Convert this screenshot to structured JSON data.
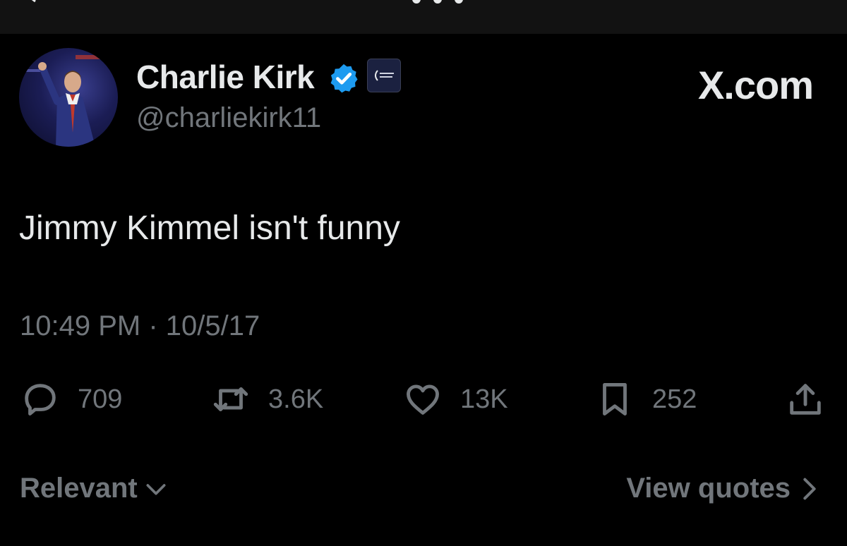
{
  "post": {
    "author": {
      "display_name": "Charlie Kirk",
      "handle": "@charliekirk11",
      "verified": true,
      "affiliate_badge": "turning-point-usa-logo"
    },
    "brand": "X.com",
    "text": "Jimmy Kimmel isn't funny",
    "timestamp": "10:49 PM · 10/5/17",
    "metrics": {
      "replies": "709",
      "reposts": "3.6K",
      "likes": "13K",
      "bookmarks": "252"
    }
  },
  "footer": {
    "sort_label": "Relevant",
    "quotes_link": "View quotes"
  },
  "icons": {
    "reply": "reply-icon",
    "repost": "repost-icon",
    "like": "like-icon",
    "bookmark": "bookmark-icon",
    "share": "share-icon"
  },
  "colors": {
    "background": "#000000",
    "topbar": "#121212",
    "text_primary": "#e7e9ea",
    "text_secondary": "#71767b",
    "verified_blue": "#1d9bf0"
  }
}
